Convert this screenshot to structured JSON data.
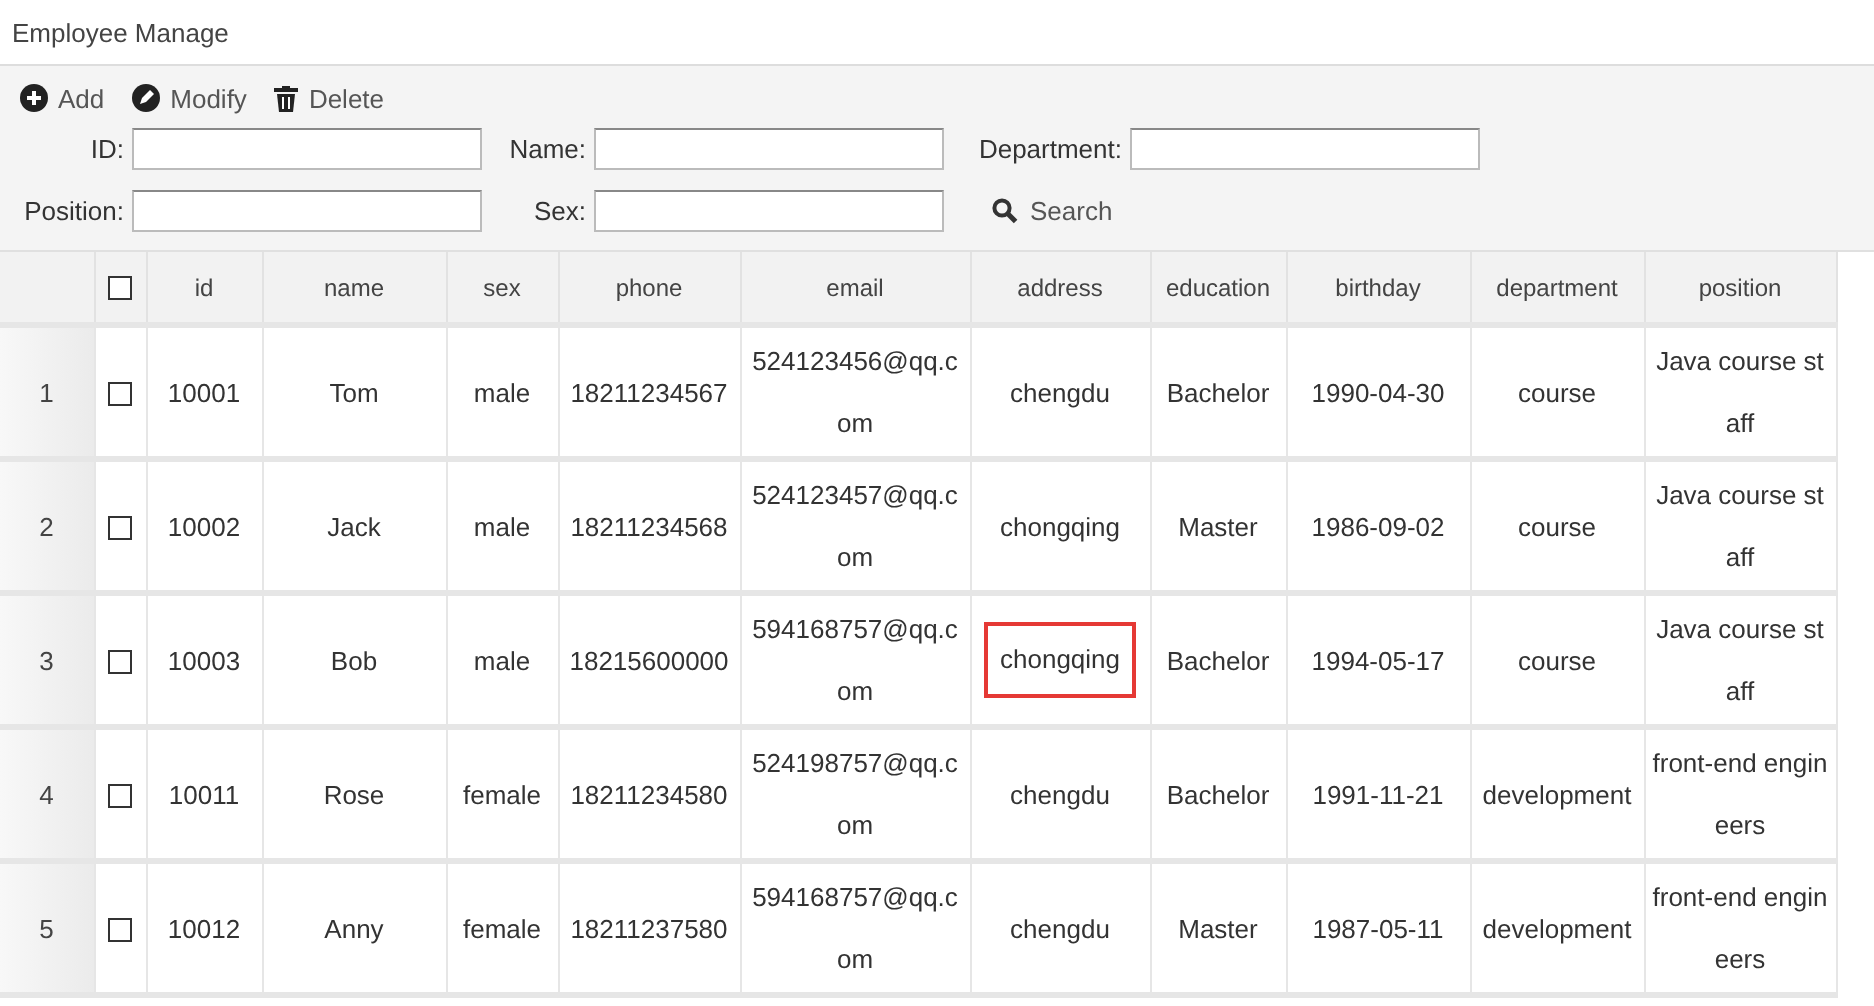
{
  "panel": {
    "title": "Employee Manage"
  },
  "toolbar": [
    {
      "kind": "add",
      "label": "Add"
    },
    {
      "kind": "edit",
      "label": "Modify"
    },
    {
      "kind": "delete",
      "label": "Delete"
    }
  ],
  "filters": [
    {
      "label": "ID:"
    },
    {
      "label": "Name:"
    },
    {
      "label": "Department:"
    },
    {
      "label": "Position:"
    },
    {
      "label": "Sex:"
    }
  ],
  "search_button": {
    "label": "Search"
  },
  "table": {
    "select_all_checked": false,
    "columns": [
      "id",
      "name",
      "sex",
      "phone",
      "email",
      "address",
      "education",
      "birthday",
      "department",
      "position"
    ],
    "rows": [
      {
        "number": "1",
        "checked": false,
        "cells": [
          "10001",
          "Tom",
          "male",
          "18211234567",
          "524123456@qq.com",
          "chengdu",
          "Bachelor",
          "1990-04-30",
          "course",
          "Java course staff"
        ],
        "address_highlighted": false
      },
      {
        "number": "2",
        "checked": false,
        "cells": [
          "10002",
          "Jack",
          "male",
          "18211234568",
          "524123457@qq.com",
          "chongqing",
          "Master",
          "1986-09-02",
          "course",
          "Java course staff"
        ],
        "address_highlighted": false
      },
      {
        "number": "3",
        "checked": false,
        "cells": [
          "10003",
          "Bob",
          "male",
          "18215600000",
          "594168757@qq.com",
          "chongqing",
          "Bachelor",
          "1994-05-17",
          "course",
          "Java course staff"
        ],
        "address_highlighted": true
      },
      {
        "number": "4",
        "checked": false,
        "cells": [
          "10011",
          "Rose",
          "female",
          "18211234580",
          "524198757@qq.com",
          "chengdu",
          "Bachelor",
          "1991-11-21",
          "development",
          "front-end engineers"
        ],
        "address_highlighted": false
      },
      {
        "number": "5",
        "checked": false,
        "cells": [
          "10012",
          "Anny",
          "female",
          "18211237580",
          "594168757@qq.com",
          "chengdu",
          "Master",
          "1987-05-11",
          "development",
          "front-end engineers"
        ],
        "address_highlighted": false
      }
    ]
  }
}
